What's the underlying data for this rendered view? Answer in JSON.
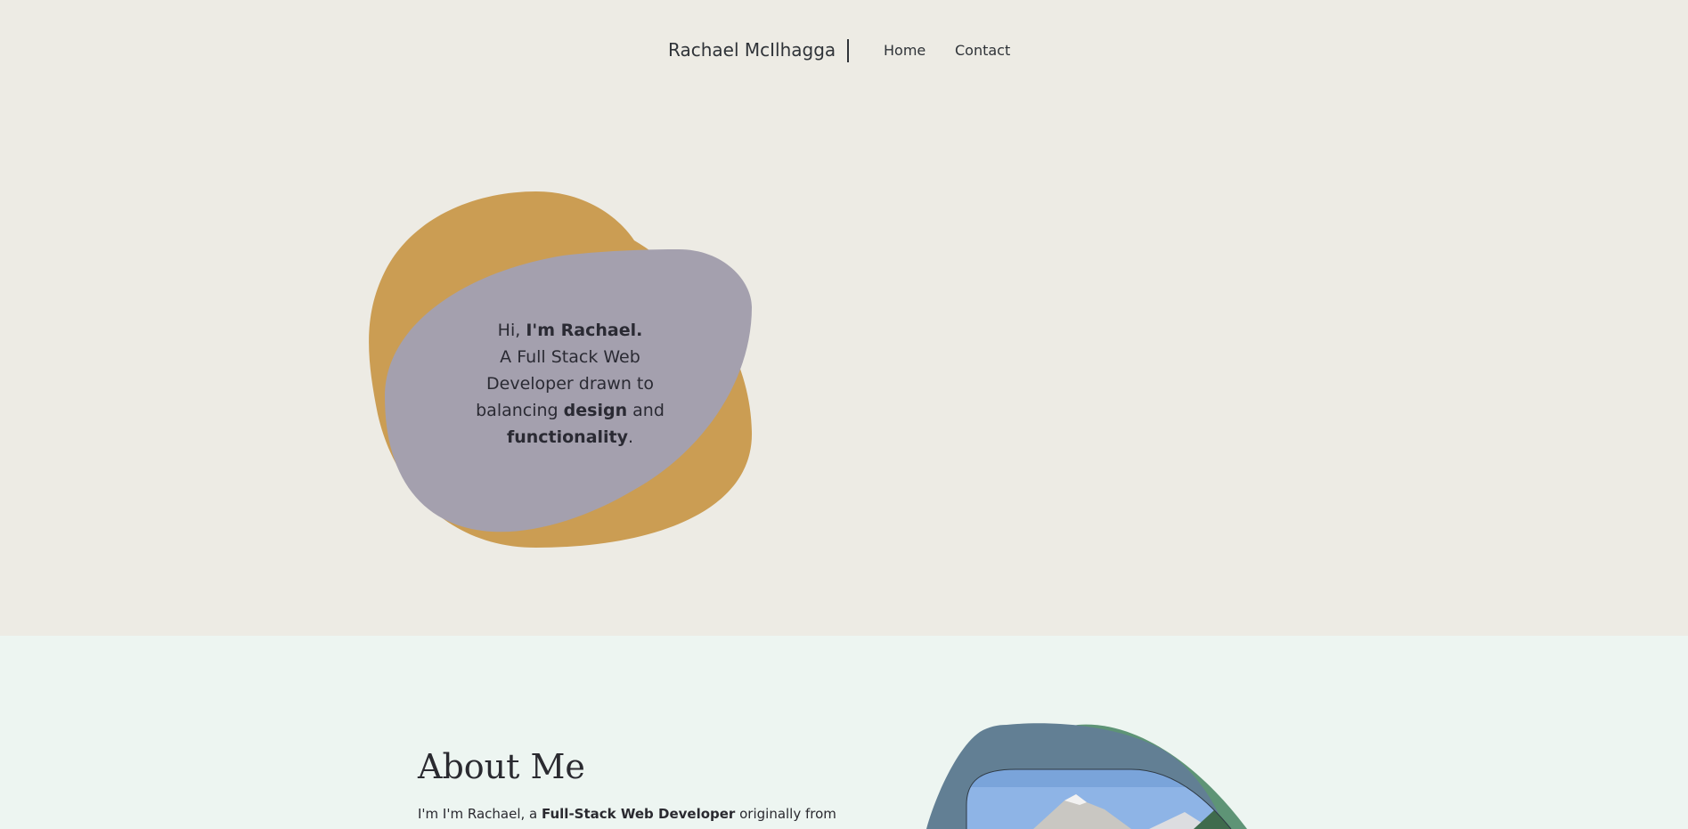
{
  "nav": {
    "brand": "Rachael McIlhagga",
    "links": [
      "Home",
      "Contact"
    ]
  },
  "hero": {
    "greeting_prefix": "Hi, ",
    "greeting_name": "I'm Rachael.",
    "line_1": "A Full Stack Web",
    "line_2": "Developer drawn to",
    "line_3_prefix": "balancing ",
    "line_3_bold": "design",
    "line_3_suffix": " and",
    "line_4_bold": "functionality",
    "line_4_suffix": "."
  },
  "about": {
    "title": "About Me",
    "intro_prefix": "I'm I'm Rachael, a ",
    "intro_bold": "Full-Stack Web Developer",
    "intro_suffix": " originally from"
  },
  "colors": {
    "hero_bg": "#edebe4",
    "about_bg": "#edf5f1",
    "blob_orange": "#cb9d53",
    "blob_lavender": "#a4a0ae",
    "blob_green": "#5e9476",
    "blob_slate": "#627f94",
    "photo_sky": "#8eb4e6"
  },
  "icons": {
    "photo": "mountain-photo"
  }
}
